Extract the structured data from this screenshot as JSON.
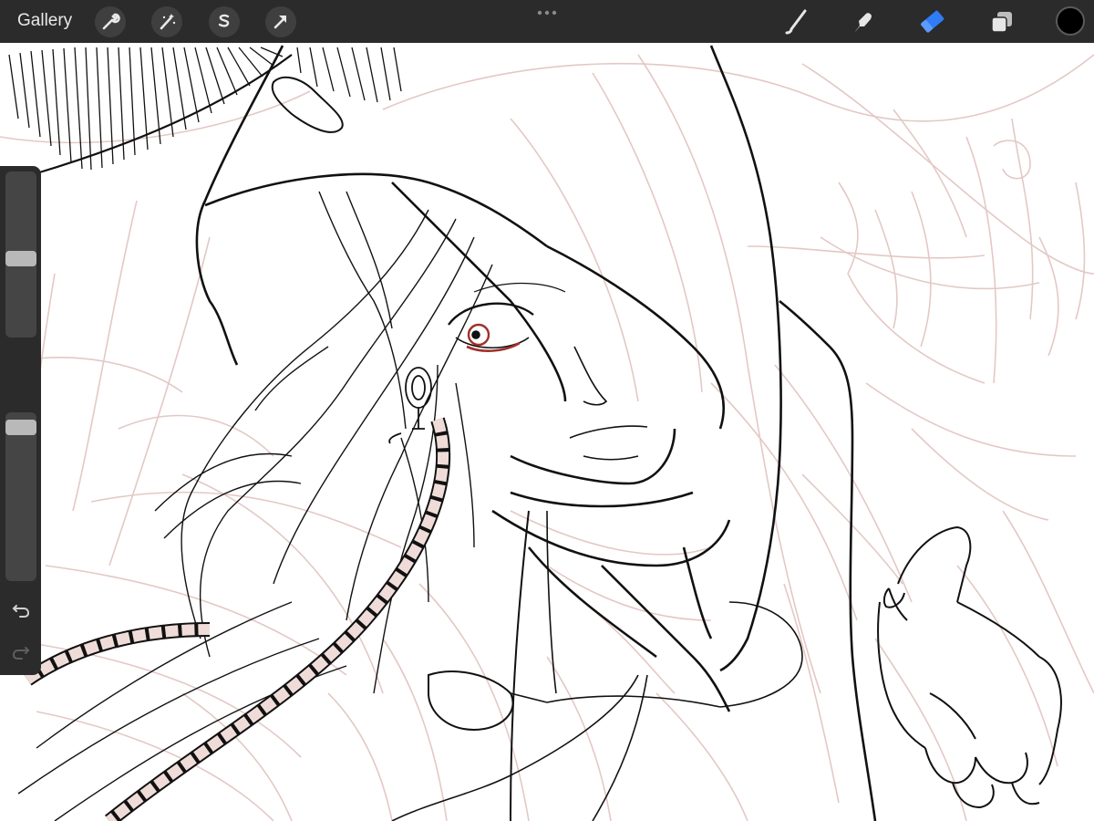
{
  "app": {
    "gallery_label": "Gallery"
  },
  "toolbar_left": [
    {
      "name": "actions-wrench-icon"
    },
    {
      "name": "adjustments-wand-icon"
    },
    {
      "name": "selection-s-icon"
    },
    {
      "name": "transform-arrow-icon"
    }
  ],
  "toolbar_right": {
    "tools": [
      "brush-icon",
      "smudge-icon",
      "eraser-icon",
      "layers-icon"
    ],
    "active_tool": "eraser-icon",
    "active_color": "#000000",
    "accent_color": "#2f7cf6"
  },
  "sidebar": {
    "brush_size_level": 0.47,
    "opacity_level": 0.95
  },
  "canvas": {
    "line_color": "#111111",
    "sketch_color": "#e2c6c2",
    "eye_color": "#a0302a",
    "braid_fill": "#efdcd8"
  }
}
